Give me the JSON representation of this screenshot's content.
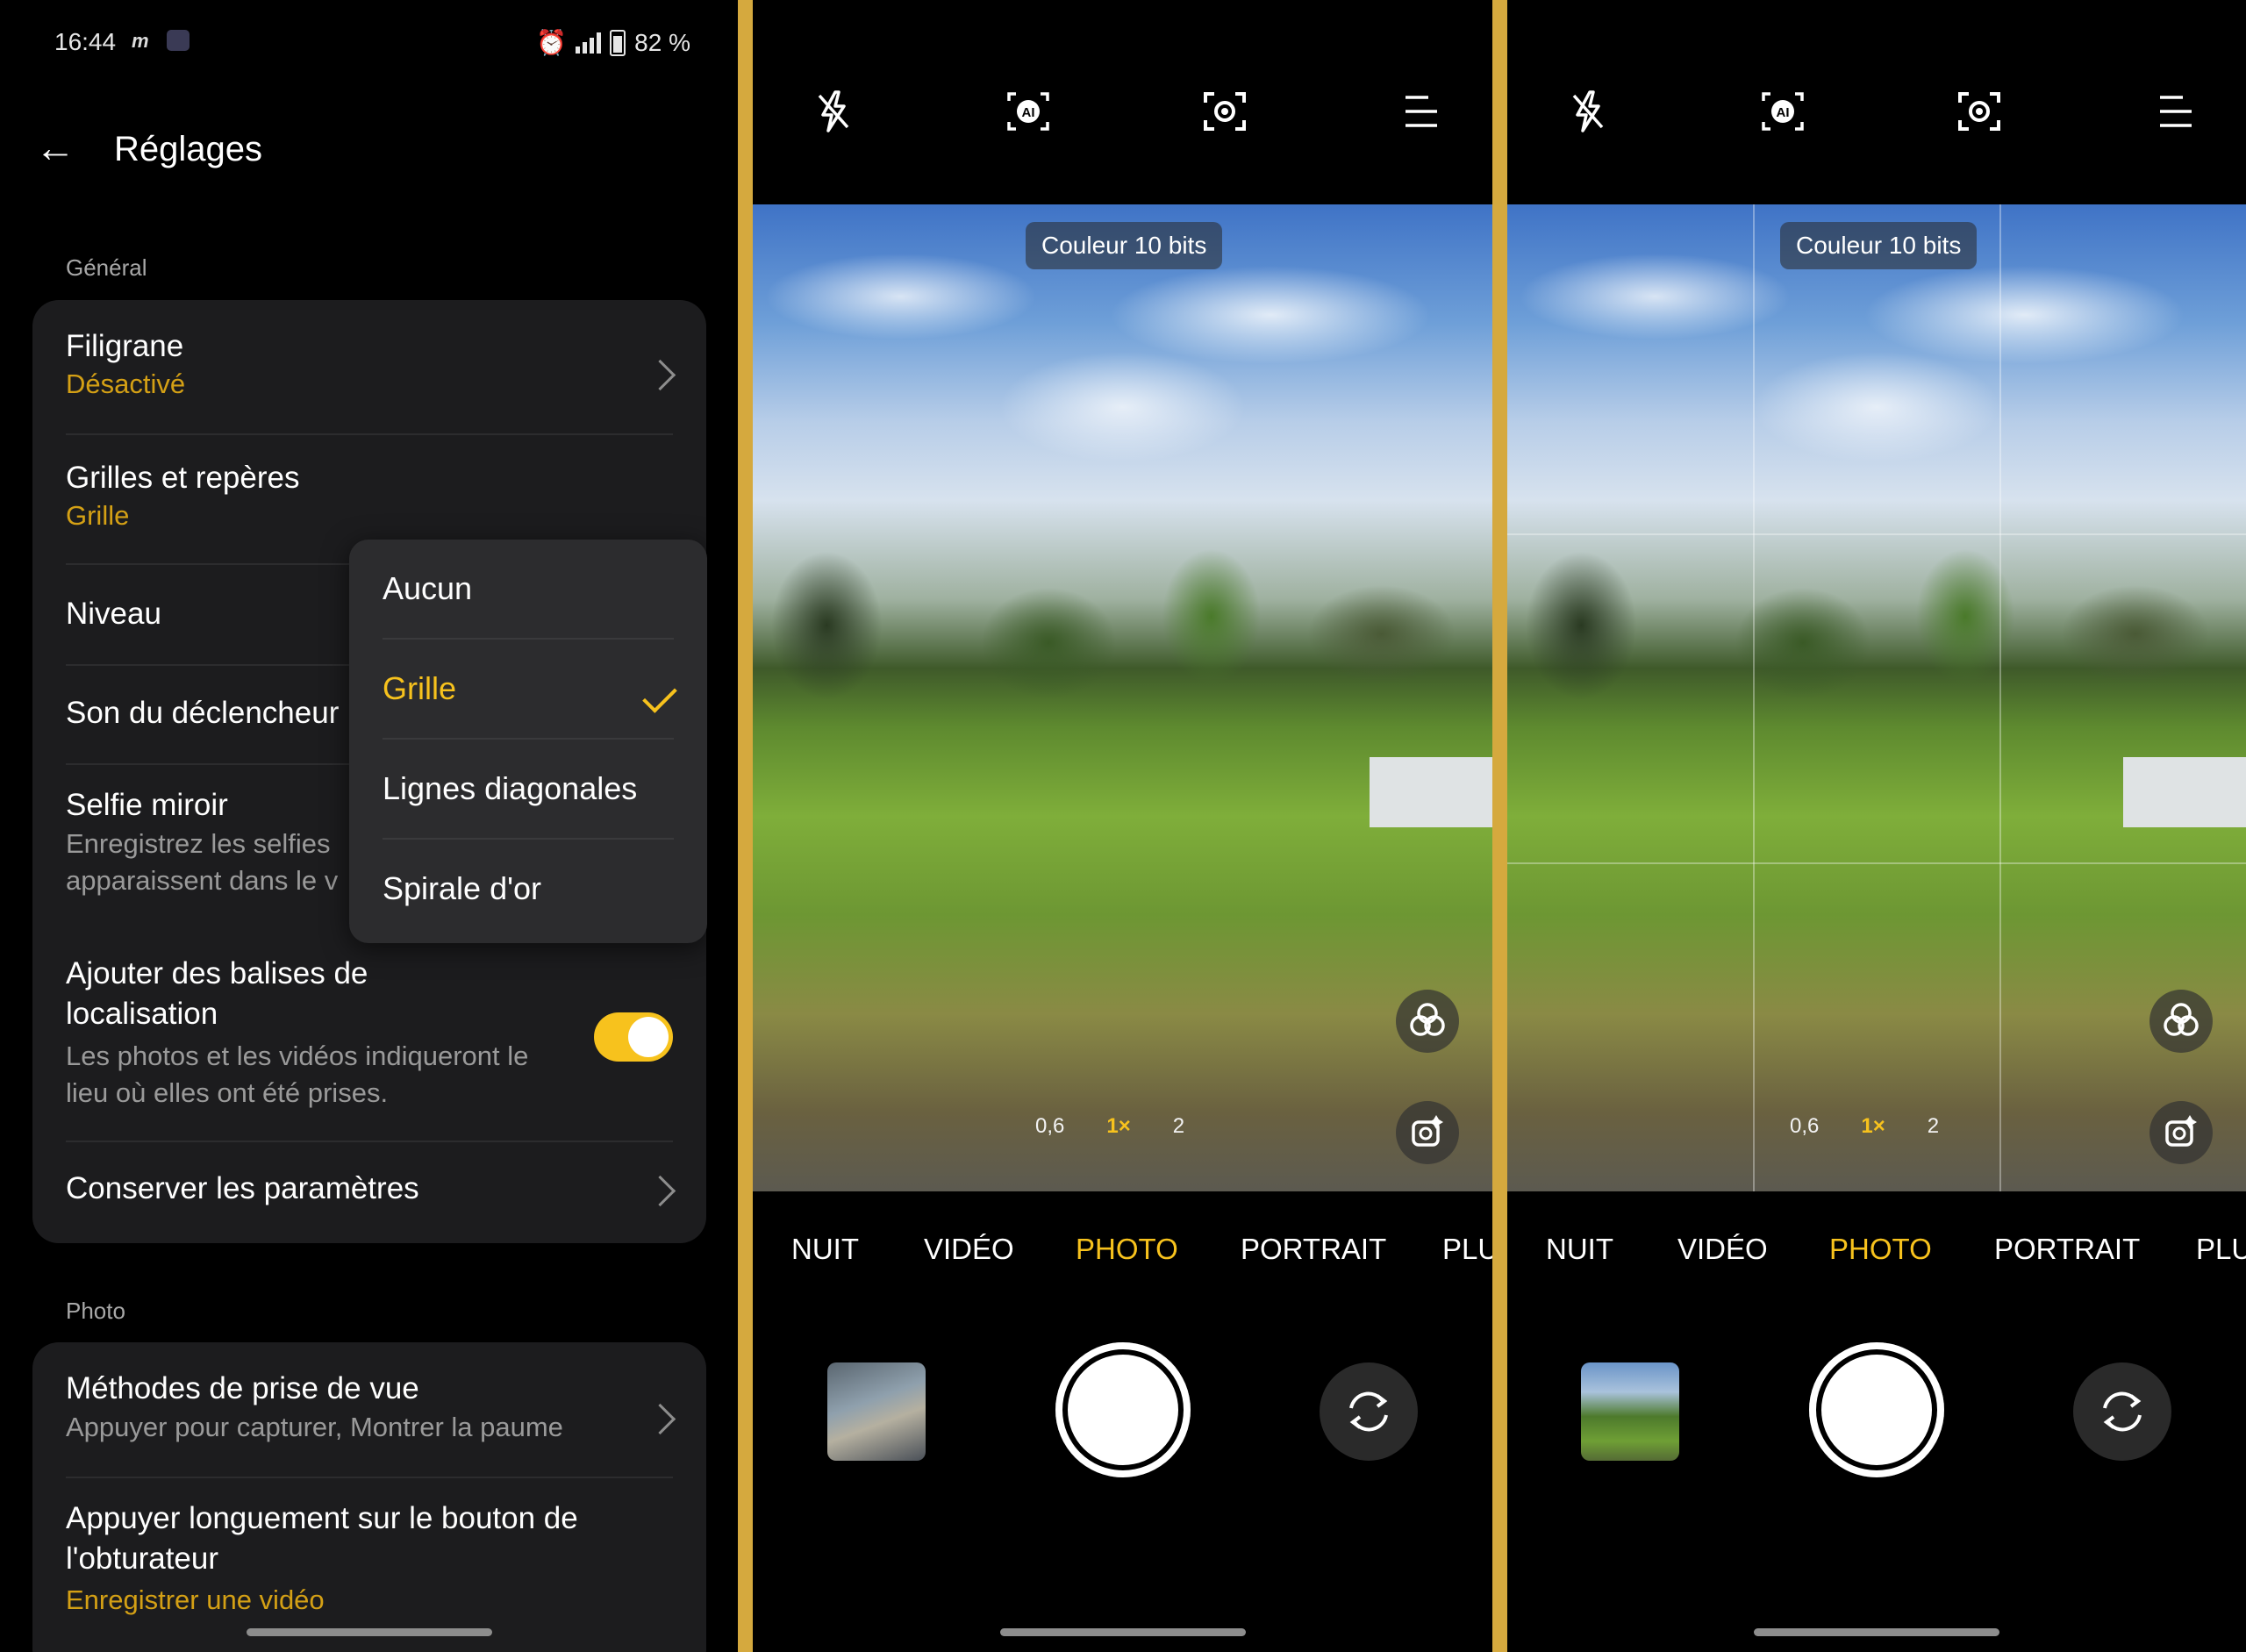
{
  "status_bar": {
    "time": "16:44",
    "battery": "82 %"
  },
  "settings": {
    "title": "Réglages",
    "sections": {
      "general": "Général",
      "photo": "Photo"
    },
    "filigrane": {
      "title": "Filigrane",
      "value": "Désactivé"
    },
    "grilles": {
      "title": "Grilles et repères",
      "value": "Grille"
    },
    "niveau": {
      "title": "Niveau"
    },
    "son": {
      "title": "Son du déclencheur"
    },
    "selfie": {
      "title": "Selfie miroir",
      "desc1": "Enregistrez les selfies",
      "desc2": "apparaissent dans le v"
    },
    "balises": {
      "title1": "Ajouter des balises de",
      "title2": "localisation",
      "desc1": "Les photos et les vidéos indiqueront le",
      "desc2": "lieu où elles ont été prises.",
      "enabled": true
    },
    "conserver": {
      "title": "Conserver les paramètres"
    },
    "methodes": {
      "title": "Méthodes de prise de vue",
      "value": "Appuyer pour capturer, Montrer la paume"
    },
    "appuyer": {
      "title1": "Appuyer longuement sur le bouton de",
      "title2": "l'obturateur",
      "value": "Enregistrer une vidéo"
    },
    "dropdown": {
      "options": [
        "Aucun",
        "Grille",
        "Lignes diagonales",
        "Spirale d'or"
      ],
      "selected": "Grille"
    }
  },
  "camera": {
    "badge": "Couleur 10 bits",
    "zoom": {
      "wide": "0,6",
      "main": "1×",
      "tele": "2"
    },
    "modes": [
      "NUIT",
      "VIDÉO",
      "PHOTO",
      "PORTRAIT",
      "PLU"
    ],
    "active_mode": "PHOTO",
    "icons": [
      "flash-off-icon",
      "ai-icon",
      "focus-icon",
      "menu-icon",
      "filters-icon",
      "retouch-icon",
      "switch-camera-icon"
    ]
  },
  "colors": {
    "accent": "#f7c21d",
    "separator": "#d5a93e",
    "card": "#1c1c1e"
  }
}
